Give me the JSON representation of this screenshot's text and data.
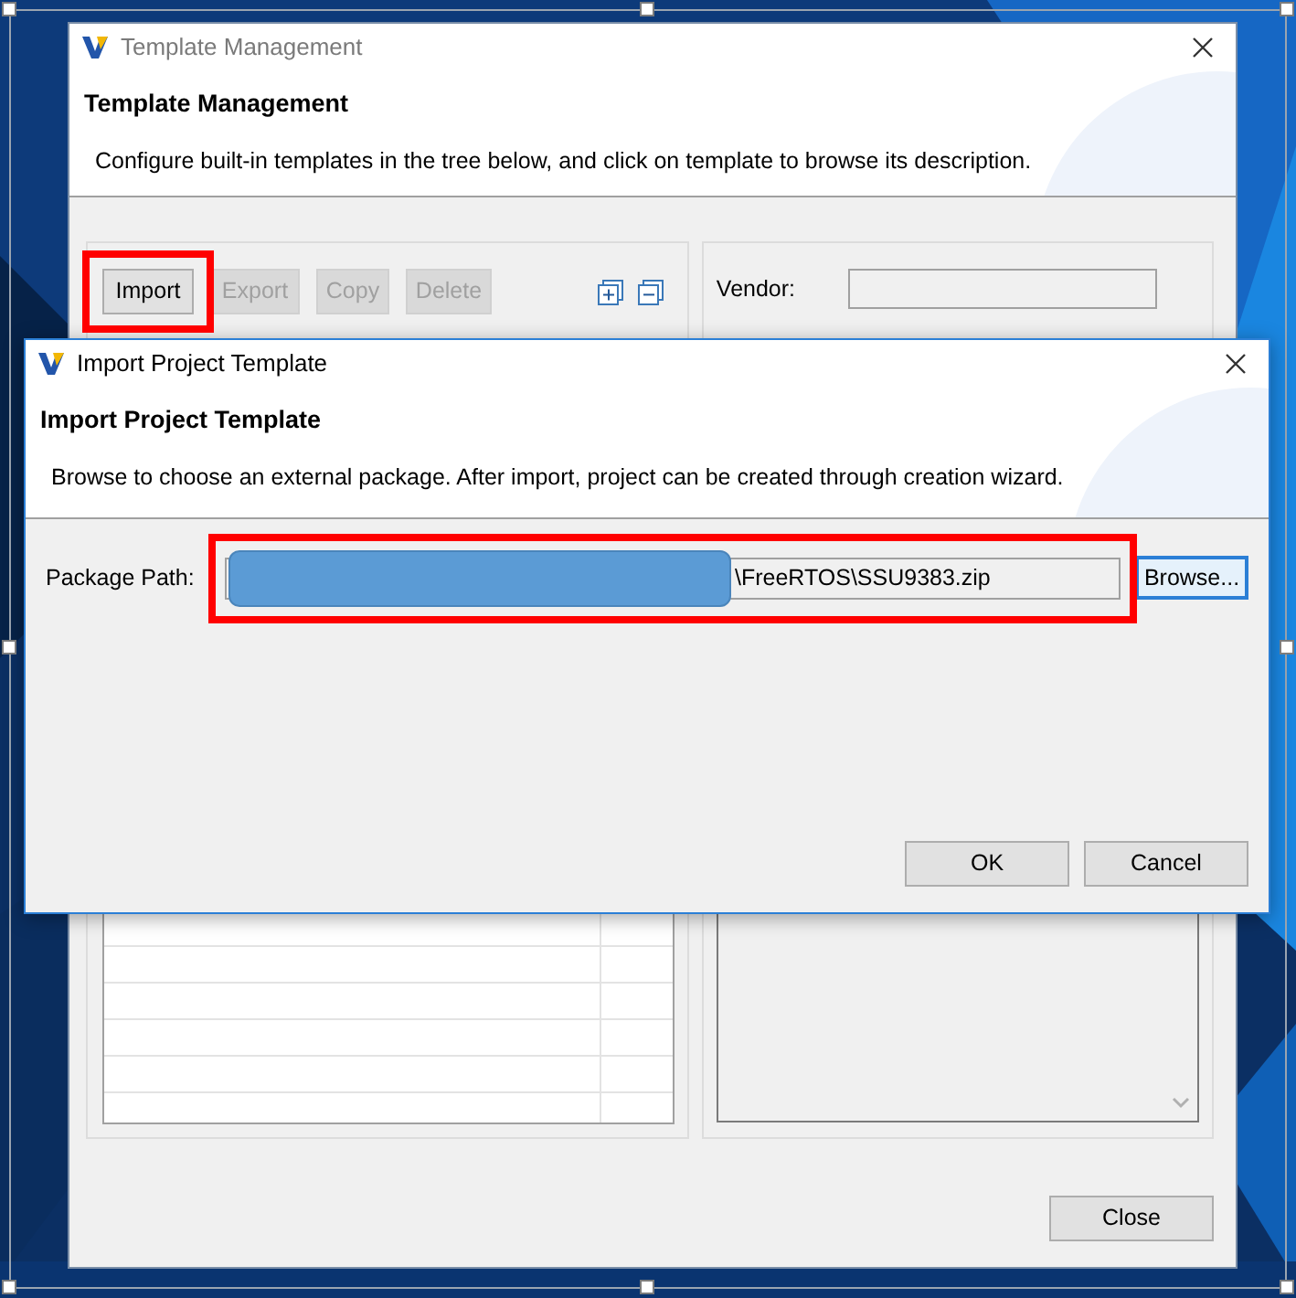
{
  "back_window": {
    "title": "Template Management",
    "header_title": "Template Management",
    "description": "Configure built-in templates in the tree below, and click on template to browse its description.",
    "toolbar": [
      {
        "label": "Import",
        "disabled": false,
        "annotated": true
      },
      {
        "label": "Export",
        "disabled": true,
        "annotated": false
      },
      {
        "label": "Copy",
        "disabled": true,
        "annotated": false
      },
      {
        "label": "Delete",
        "disabled": true,
        "annotated": false
      }
    ],
    "vendor_label": "Vendor:",
    "close_button": "Close"
  },
  "dialog": {
    "title": "Import Project Template",
    "header_title": "Import Project Template",
    "description": "Browse to choose an external package. After import, project can be created through creation wizard.",
    "package_path_label": "Package Path:",
    "package_path_value": "\\FreeRTOS\\SSU9383.zip",
    "redacted": true,
    "annotated": true,
    "browse_button": {
      "label": "Browse...",
      "focused": true
    },
    "buttons": [
      "OK",
      "Cancel"
    ]
  }
}
